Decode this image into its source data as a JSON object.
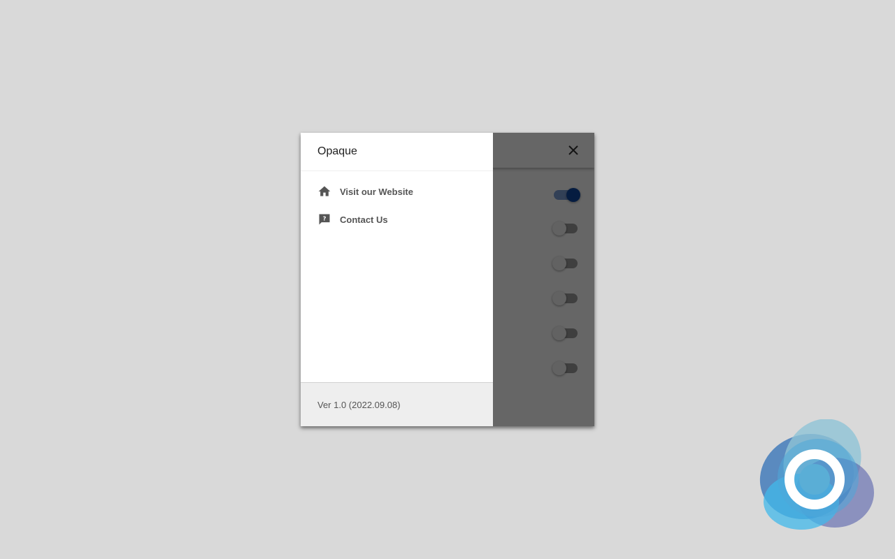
{
  "drawer": {
    "title": "Opaque",
    "items": [
      {
        "label": "Visit our Website",
        "icon": "home-icon"
      },
      {
        "label": "Contact Us",
        "icon": "help-chat-icon"
      }
    ],
    "footer": {
      "version": "Ver 1.0 (2022.09.08)"
    }
  },
  "app": {
    "close_icon": "close-icon",
    "toggles": [
      {
        "state": "on"
      },
      {
        "state": "off"
      },
      {
        "state": "off"
      },
      {
        "state": "off"
      },
      {
        "state": "off"
      },
      {
        "state": "off"
      }
    ]
  },
  "colors": {
    "background": "#d9d9d9",
    "accent": "#0d47a1",
    "scrim": "rgba(0,0,0,0.6)",
    "footer": "#eeeeee",
    "icon_text": "#555555"
  },
  "brand_logo": {
    "icon": "app-logo-icon"
  }
}
